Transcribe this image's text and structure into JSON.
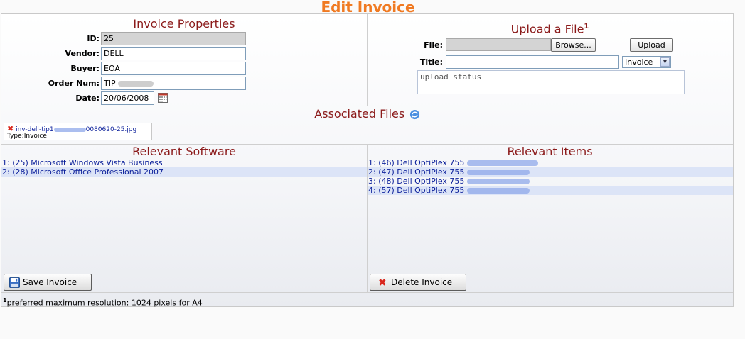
{
  "page": {
    "title": "Edit Invoice"
  },
  "invoice_properties": {
    "title": "Invoice Properties",
    "id_label": "ID:",
    "id_value": "25",
    "vendor_label": "Vendor:",
    "vendor_value": "DELL",
    "buyer_label": "Buyer:",
    "buyer_value": "EOA",
    "order_label": "Order Num:",
    "order_value": "TIP",
    "date_label": "Date:",
    "date_value": "20/06/2008"
  },
  "upload": {
    "title": "Upload a File",
    "footnote_mark": "1",
    "file_label": "File:",
    "browse_label": "Browse...",
    "upload_label": "Upload",
    "title_label": "Title:",
    "title_value": "",
    "type_selected": "Invoice",
    "status_text": "upload status"
  },
  "associated": {
    "title": "Associated Files",
    "file_name_prefix": "inv-dell-tip1",
    "file_name_suffix": "0080620-25.jpg",
    "file_type": "Type:Invoice"
  },
  "software": {
    "title": "Relevant Software",
    "items": [
      "1: (25) Microsoft Windows Vista Business",
      "2: (28) Microsoft Office Professional 2007"
    ]
  },
  "items": {
    "title": "Relevant Items",
    "rows": [
      "1: (46) Dell OptiPlex 755",
      "2: (47) Dell OptiPlex 755",
      "3: (48) Dell OptiPlex 755",
      "4: (57) Dell OptiPlex 755"
    ]
  },
  "actions": {
    "save_label": "Save Invoice",
    "delete_label": "Delete Invoice"
  },
  "footnote": {
    "mark": "1",
    "text": "preferred maximum resolution: 1024 pixels for A4"
  },
  "colors": {
    "title": "#f07a22",
    "section": "#8b1a1a",
    "link": "#0a1e9a",
    "alt_row": "#dce4f7"
  }
}
